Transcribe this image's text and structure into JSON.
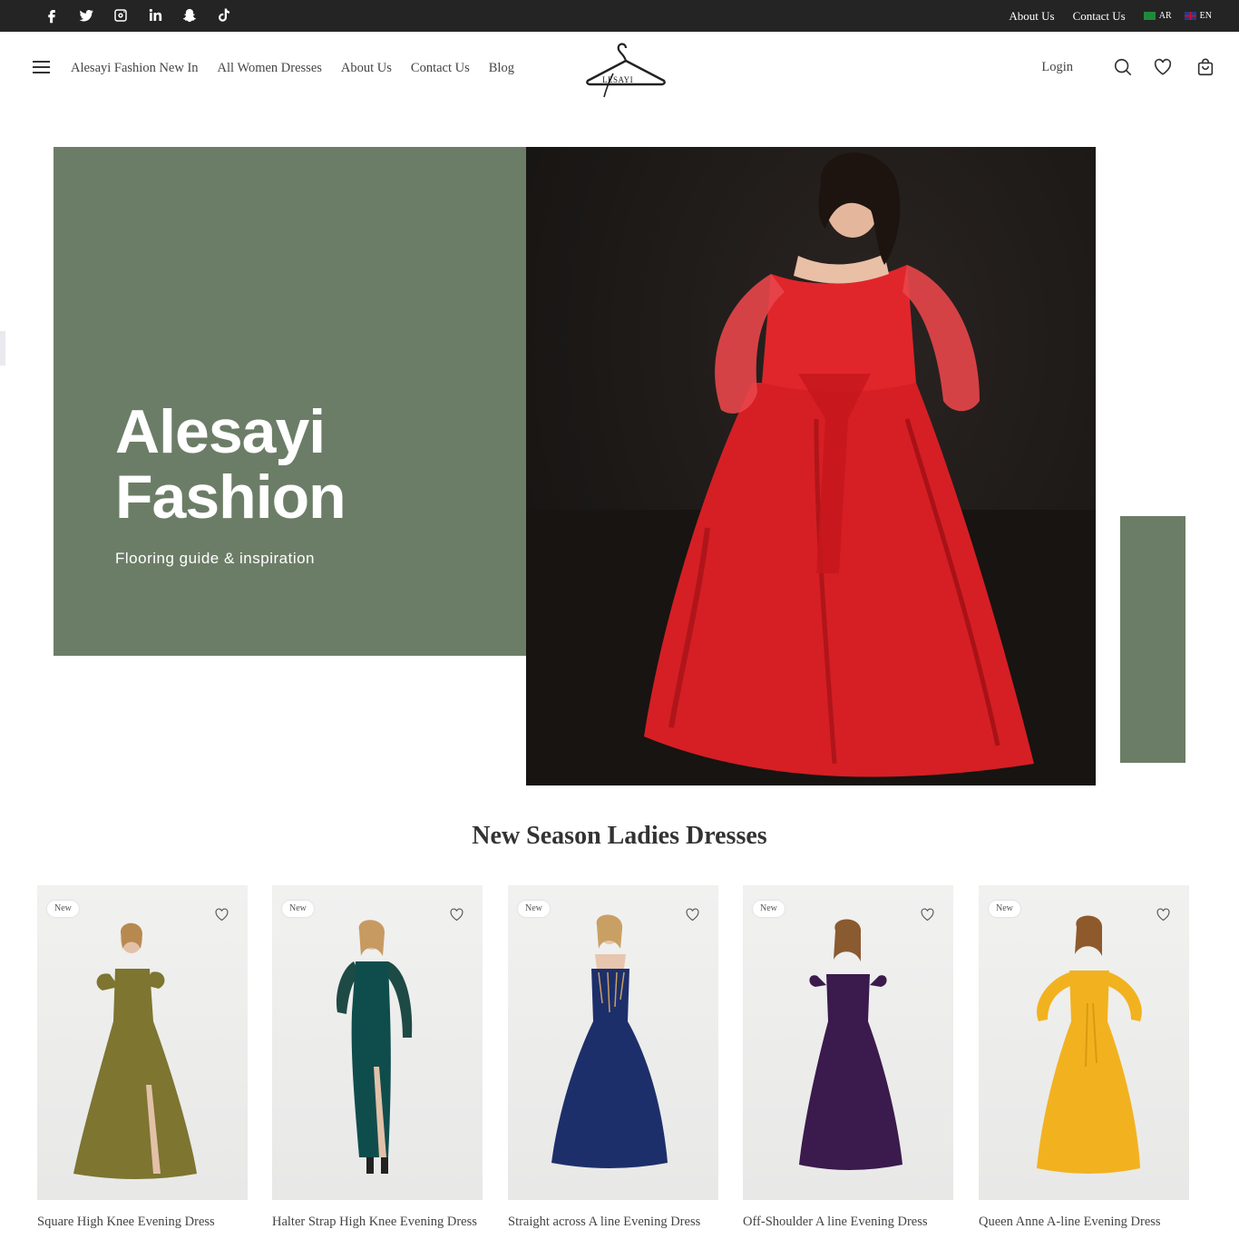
{
  "topbar": {
    "social_icons": [
      "facebook-icon",
      "twitter-icon",
      "instagram-icon",
      "linkedin-icon",
      "snapchat-icon",
      "tiktok-icon"
    ],
    "about_label": "About Us",
    "contact_label": "Contact Us",
    "lang_ar": "AR",
    "lang_en": "EN"
  },
  "header": {
    "nav": [
      "Alesayi Fashion New In",
      "All Women Dresses",
      "About Us",
      "Contact Us",
      "Blog"
    ],
    "logo_text": "LESAYI",
    "login_label": "Login",
    "tools": [
      "search-icon",
      "wishlist-icon",
      "cart-icon"
    ]
  },
  "hero": {
    "title_line1": "Alesayi",
    "title_line2": "Fashion",
    "subtitle": "Flooring guide & inspiration",
    "accent_color": "#6c7d67"
  },
  "section": {
    "title": "New Season Ladies Dresses"
  },
  "products": [
    {
      "badge": "New",
      "name": "Square High Knee Evening Dress",
      "dress_color": "#7d7530"
    },
    {
      "badge": "New",
      "name": "Halter Strap High Knee Evening Dress",
      "dress_color": "#0f4d4d"
    },
    {
      "badge": "New",
      "name": "Straight across A line Evening Dress",
      "dress_color": "#1d2f6b"
    },
    {
      "badge": "New",
      "name": "Off-Shoulder A line Evening Dress",
      "dress_color": "#3b1a4d"
    },
    {
      "badge": "New",
      "name": "Queen Anne A-line Evening Dress",
      "dress_color": "#f2b21f"
    }
  ]
}
